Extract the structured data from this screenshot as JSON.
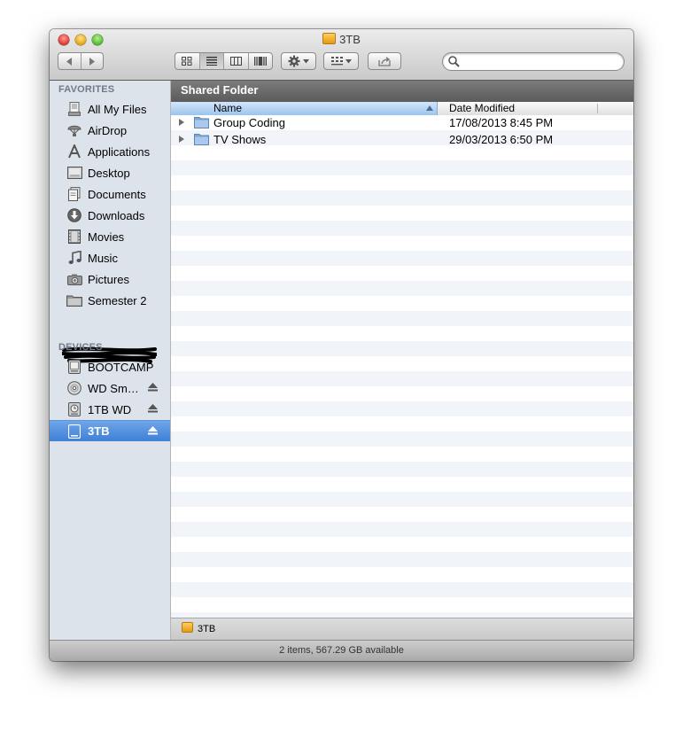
{
  "window": {
    "title": "3TB"
  },
  "toolbar": {
    "search_placeholder": "",
    "view_modes": [
      "icon-view",
      "list-view",
      "column-view",
      "cover-flow-view"
    ],
    "active_view": "list-view"
  },
  "sidebar": {
    "favorites_heading": "FAVORITES",
    "favorites": [
      {
        "label": "All My Files",
        "icon": "all-files-icon"
      },
      {
        "label": "AirDrop",
        "icon": "airdrop-icon"
      },
      {
        "label": "Applications",
        "icon": "applications-icon"
      },
      {
        "label": "Desktop",
        "icon": "desktop-icon"
      },
      {
        "label": "Documents",
        "icon": "documents-icon"
      },
      {
        "label": "Downloads",
        "icon": "downloads-icon"
      },
      {
        "label": "Movies",
        "icon": "movies-icon"
      },
      {
        "label": "Music",
        "icon": "music-icon"
      },
      {
        "label": "Pictures",
        "icon": "pictures-icon"
      },
      {
        "label": "Semester 2",
        "icon": "folder-icon"
      }
    ],
    "devices_heading": "DEVICES",
    "devices": [
      {
        "label": "BOOTCAMP",
        "icon": "hard-drive-icon",
        "eject": false
      },
      {
        "label": "WD Sm…",
        "icon": "disc-icon",
        "eject": true
      },
      {
        "label": "1TB WD",
        "icon": "time-machine-drive-icon",
        "eject": true
      },
      {
        "label": "3TB",
        "icon": "external-drive-icon",
        "eject": true,
        "selected": true
      }
    ]
  },
  "main": {
    "path_header": "Shared Folder",
    "columns": {
      "name": "Name",
      "date": "Date Modified"
    },
    "rows": [
      {
        "name": "Group Coding",
        "date": "17/08/2013 8:45 PM"
      },
      {
        "name": "TV Shows",
        "date": "29/03/2013 6:50 PM"
      }
    ],
    "pathbar": "3TB"
  },
  "status": {
    "text": "2 items, 567.29 GB available"
  },
  "colors": {
    "selection": "#3f7fd6",
    "sidebar_bg": "#dde3ea",
    "folder": "#8fb5de"
  }
}
